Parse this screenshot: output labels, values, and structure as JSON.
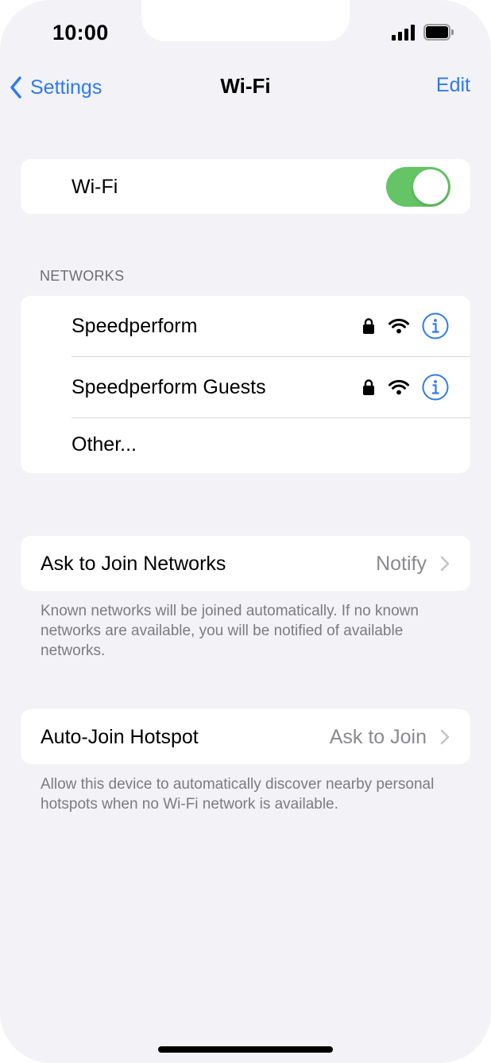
{
  "status_bar": {
    "time": "10:00",
    "signal_icon": "cellular-signal-icon",
    "battery_icon": "battery-icon"
  },
  "nav": {
    "back_label": "Settings",
    "title": "Wi-Fi",
    "edit_label": "Edit"
  },
  "wifi_toggle": {
    "label": "Wi-Fi",
    "on": true,
    "on_color": "#65c466"
  },
  "networks": {
    "header": "NETWORKS",
    "items": [
      {
        "name": "Speedperform",
        "secured": true,
        "icons": [
          "lock-icon",
          "wifi-signal-icon",
          "info-icon"
        ]
      },
      {
        "name": "Speedperform Guests",
        "secured": true,
        "icons": [
          "lock-icon",
          "wifi-signal-icon",
          "info-icon"
        ]
      }
    ],
    "other_label": "Other..."
  },
  "ask_to_join": {
    "label": "Ask to Join Networks",
    "value": "Notify",
    "footnote": "Known networks will be joined automatically. If no known networks are available, you will be notified of available networks."
  },
  "auto_join_hotspot": {
    "label": "Auto-Join Hotspot",
    "value": "Ask to Join",
    "footnote": "Allow this device to automatically discover nearby personal hotspots when no Wi-Fi network is available."
  },
  "colors": {
    "accent": "#2f7af0",
    "background": "#f2f2f7",
    "secondary_text": "#8a8a8e"
  }
}
